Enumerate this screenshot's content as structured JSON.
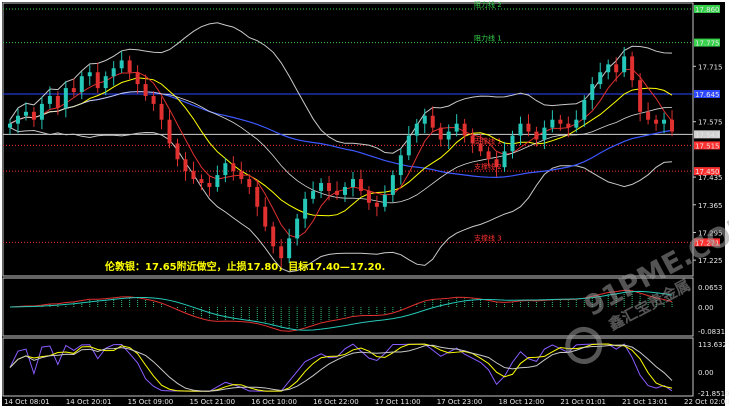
{
  "chart_data": {
    "type": "line",
    "subtype": "candlestick",
    "time_labels": [
      "14 Oct 08:01",
      "14 Oct 20:01",
      "15 Oct 09:00",
      "15 Oct 21:00",
      "16 Oct 10:00",
      "16 Oct 22:00",
      "17 Oct 11:00",
      "17 Oct 23:00",
      "18 Oct 12:00",
      "21 Oct 01:01",
      "21 Oct 13:01",
      "22 Oct 02:00"
    ],
    "price_ticks": [
      "17.715",
      "17.575",
      "17.435",
      "17.365",
      "17.295",
      "17.225"
    ],
    "price_range": [
      17.19,
      17.87
    ],
    "levels": [
      {
        "label": "阻力线 2",
        "price": 17.86,
        "tag": "17.860",
        "color": "#35d24a",
        "style": "dotted"
      },
      {
        "label": "阻力线 1",
        "price": 17.775,
        "tag": "17.775",
        "color": "#35d24a",
        "style": "dotted"
      },
      {
        "label": "",
        "price": 17.645,
        "tag": "17.645",
        "color": "#2d46ff",
        "style": "solid"
      },
      {
        "label": "",
        "price": 17.543,
        "tag": "17.543",
        "color": "#d0d0d0",
        "style": "solid"
      },
      {
        "label": "支撑线 1",
        "price": 17.515,
        "tag": "17.515",
        "color": "#ff3030",
        "style": "dotted"
      },
      {
        "label": "支撑线 2",
        "price": 17.45,
        "tag": "17.450",
        "color": "#ff3030",
        "style": "dotted"
      },
      {
        "label": "支撑线 3",
        "price": 17.27,
        "tag": "17.271",
        "color": "#ff3030",
        "style": "dotted"
      }
    ],
    "annotation": "伦敦银：17.65附近做空，止损17.80，目标17.40—17.20.",
    "close_series": [
      17.57,
      17.59,
      17.6,
      17.58,
      17.62,
      17.64,
      17.61,
      17.66,
      17.65,
      17.69,
      17.7,
      17.66,
      17.69,
      17.71,
      17.73,
      17.7,
      17.67,
      17.64,
      17.62,
      17.58,
      17.52,
      17.48,
      17.45,
      17.43,
      17.42,
      17.41,
      17.44,
      17.47,
      17.45,
      17.43,
      17.41,
      17.36,
      17.31,
      17.26,
      17.23,
      17.28,
      17.33,
      17.38,
      17.4,
      17.42,
      17.4,
      17.39,
      17.41,
      17.43,
      17.4,
      17.37,
      17.36,
      17.39,
      17.44,
      17.49,
      17.54,
      17.57,
      17.59,
      17.56,
      17.53,
      17.55,
      17.57,
      17.54,
      17.52,
      17.5,
      17.48,
      17.46,
      17.5,
      17.54,
      17.57,
      17.55,
      17.53,
      17.56,
      17.58,
      17.57,
      17.56,
      17.58,
      17.63,
      17.67,
      17.7,
      17.72,
      17.7,
      17.74,
      17.68,
      17.6,
      17.58,
      17.57,
      17.58,
      17.55
    ],
    "panels": [
      {
        "name": "MACD histogram",
        "ticks": [
          "0.0653",
          "0.00",
          "-0.0831"
        ]
      },
      {
        "name": "Oscillator",
        "ticks": [
          "113.6327",
          "0.00",
          "-21.8519"
        ]
      }
    ],
    "watermark": "91PME.COM",
    "watermark_sub": "鑫汇宝贵金属",
    "grid": false
  },
  "colors": {
    "background": "#000000",
    "frame": "#c8c8c8",
    "bull": "#25c8b8",
    "bear": "#e03030",
    "ma": "#d8d8d8",
    "bands": "#c8c8c8",
    "fast": "#ffff00",
    "slow": "#3d58ff",
    "macd_pos": "#2fbf76",
    "macd_neg": "#2fbf76"
  }
}
